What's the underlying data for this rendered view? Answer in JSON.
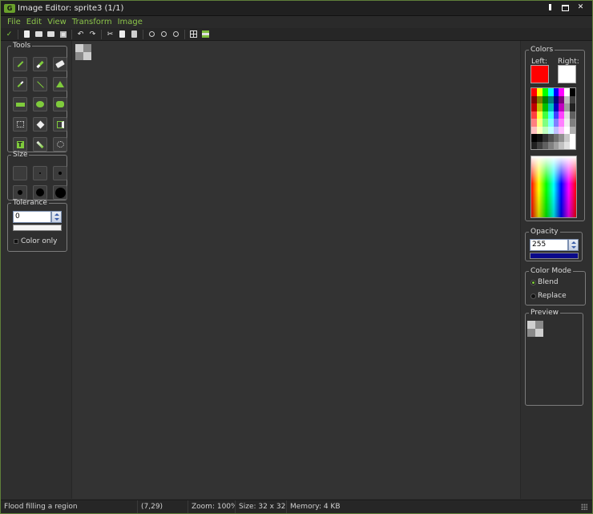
{
  "window": {
    "title": "Image Editor: sprite3 (1/1)",
    "logo_icon": "app-logo-icon",
    "controls": [
      "minimize-icon",
      "maximize-icon",
      "close-icon"
    ],
    "close_label": "✕"
  },
  "menu": [
    "File",
    "Edit",
    "View",
    "Transform",
    "Image"
  ],
  "toolbar": {
    "buttons": [
      "apply-check-icon",
      "new-icon",
      "open-icon",
      "open-from-icon",
      "save-icon",
      "undo-icon",
      "redo-icon",
      "cut-icon",
      "copy-icon",
      "paste-icon",
      "zoom-in-icon",
      "zoom-out-icon",
      "zoom-reset-icon",
      "grid-icon",
      "strip-icon"
    ],
    "check_glyph": "✓"
  },
  "tools": {
    "legend": "Tools",
    "items": [
      "pencil-icon",
      "brush-icon",
      "eraser-icon",
      "color-picker-icon",
      "line-icon",
      "fill-bucket-icon",
      "rectangle-icon",
      "ellipse-icon",
      "rounded-rectangle-icon",
      "select-rectangle-icon",
      "move-icon",
      "crop-icon",
      "text-icon",
      "gradient-icon",
      "lasso-icon"
    ],
    "text_glyph": "T"
  },
  "size": {
    "legend": "Size"
  },
  "tolerance": {
    "legend": "Tolerance",
    "value": "0",
    "color_only_label": "Color only",
    "color_only_checked": false
  },
  "colors": {
    "legend": "Colors",
    "left_label": "Left:",
    "right_label": "Right:",
    "left_color": "#ff0000",
    "right_color": "#ffffff",
    "palette_rows": [
      [
        "#ff0000",
        "#ffff00",
        "#00ff00",
        "#00ffff",
        "#0000ff",
        "#ff00ff",
        "#ffffff",
        "#000000"
      ],
      [
        "#800000",
        "#808000",
        "#008000",
        "#008080",
        "#000080",
        "#800080",
        "#c0c0c0",
        "#404040"
      ],
      [
        "#c00000",
        "#c0c000",
        "#00c000",
        "#00c0c0",
        "#0000c0",
        "#c000c0",
        "#a0a0a0",
        "#202020"
      ],
      [
        "#ff4040",
        "#ffff40",
        "#40ff40",
        "#40ffff",
        "#4040ff",
        "#ff40ff",
        "#e0e0e0",
        "#606060"
      ],
      [
        "#ff8080",
        "#ffff80",
        "#80ff80",
        "#80ffff",
        "#8080ff",
        "#ff80ff",
        "#f0f0f0",
        "#808080"
      ],
      [
        "#ffc0c0",
        "#ffffc0",
        "#c0ffc0",
        "#c0ffff",
        "#c0c0ff",
        "#ffc0ff",
        "#ffffff",
        "#b0b0b0"
      ],
      [
        "#000000",
        "#101010",
        "#303030",
        "#505050",
        "#707070",
        "#909090",
        "#c8c8c8",
        "#ffffff"
      ],
      [
        "#202020",
        "#404040",
        "#606060",
        "#808080",
        "#a0a0a0",
        "#c0c0c0",
        "#e0e0e0",
        "#ffffff"
      ]
    ]
  },
  "opacity": {
    "legend": "Opacity",
    "value": "255",
    "bar_color": "#0a0a8a"
  },
  "color_mode": {
    "legend": "Color Mode",
    "options": [
      "Blend",
      "Replace"
    ],
    "selected": "Blend"
  },
  "preview": {
    "legend": "Preview"
  },
  "status": {
    "message": "Flood filling a region",
    "coords": "(7,29)",
    "zoom": "Zoom: 100%",
    "size": "Size: 32 x 32",
    "memory": "Memory: 4 KB"
  },
  "accent_color": "#7fcb3c"
}
